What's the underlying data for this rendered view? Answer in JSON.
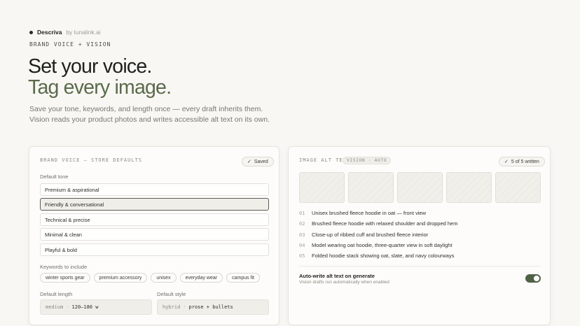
{
  "brand": {
    "name": "Descriva",
    "by": "by lunalink.ai"
  },
  "eyebrow": "BRAND VOICE + VISION",
  "headline": {
    "line1": "Set your voice.",
    "line2": "Tag every image."
  },
  "lede": {
    "line1": "Save your tone, keywords, and length once — every draft inherits them.",
    "line2": "Vision reads your product photos and writes accessible alt text on its own."
  },
  "voice_card": {
    "title": "BRAND VOICE — STORE DEFAULTS",
    "saved_label": "Saved",
    "tone_label": "Default tone",
    "tones": [
      {
        "label": "Premium & aspirational",
        "selected": false
      },
      {
        "label": "Friendly & conversational",
        "selected": true
      },
      {
        "label": "Technical & precise",
        "selected": false
      },
      {
        "label": "Minimal & clean",
        "selected": false
      },
      {
        "label": "Playful & bold",
        "selected": false
      }
    ],
    "keywords_label": "Keywords to include",
    "keywords": [
      "winter sports gear",
      "premium accessory",
      "unisex",
      "everyday wear",
      "campus fit"
    ],
    "length_label": "Default length",
    "length_key": "medium",
    "length_value": "120–180 w",
    "style_label": "Default style",
    "style_key": "hybrid",
    "style_value": "prose + bullets"
  },
  "alt_card": {
    "title": "IMAGE ALT TEXT",
    "vision_tag": "VISION · AUTO",
    "written_label": "5 of 5 written",
    "items": [
      {
        "num": "01",
        "text": "Unisex brushed fleece hoodie in oat — front view"
      },
      {
        "num": "02",
        "text": "Brushed fleece hoodie with relaxed shoulder and dropped hem"
      },
      {
        "num": "03",
        "text": "Close-up of ribbed cuff and brushed fleece interior"
      },
      {
        "num": "04",
        "text": "Model wearing oat hoodie, three-quarter view in soft daylight"
      },
      {
        "num": "05",
        "text": "Folded hoodie stack showing oat, slate, and navy colourways"
      }
    ],
    "auto_title": "Auto-write alt text on generate",
    "auto_sub": "Vision drafts run automatically when enabled",
    "auto_enabled": true
  },
  "colors": {
    "accent_green": "#5a6b4c",
    "toggle_on": "#4f6246"
  }
}
